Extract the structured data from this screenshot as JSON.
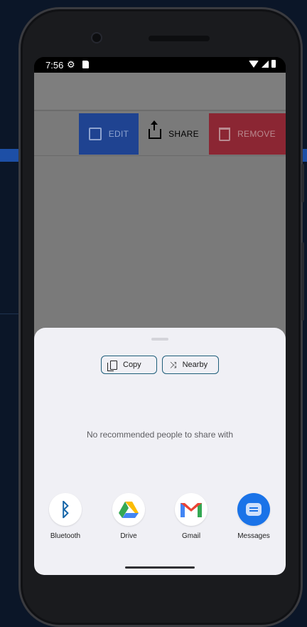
{
  "status_bar": {
    "time": "7:56"
  },
  "swipe_actions": {
    "edit_label": "EDIT",
    "share_label": "SHARE",
    "remove_label": "REMOVE"
  },
  "share_sheet": {
    "copy_label": "Copy",
    "nearby_label": "Nearby",
    "empty_message": "No recommended people to share with",
    "targets": [
      {
        "label": "Bluetooth",
        "icon": "bluetooth-icon"
      },
      {
        "label": "Drive",
        "icon": "drive-icon"
      },
      {
        "label": "Gmail",
        "icon": "gmail-icon"
      },
      {
        "label": "Messages",
        "icon": "messages-icon"
      }
    ]
  },
  "colors": {
    "edit_bg": "#1f4391",
    "remove_bg": "#8b2633",
    "chip_border": "#1f5e7a",
    "messages_blue": "#1a73e8"
  }
}
